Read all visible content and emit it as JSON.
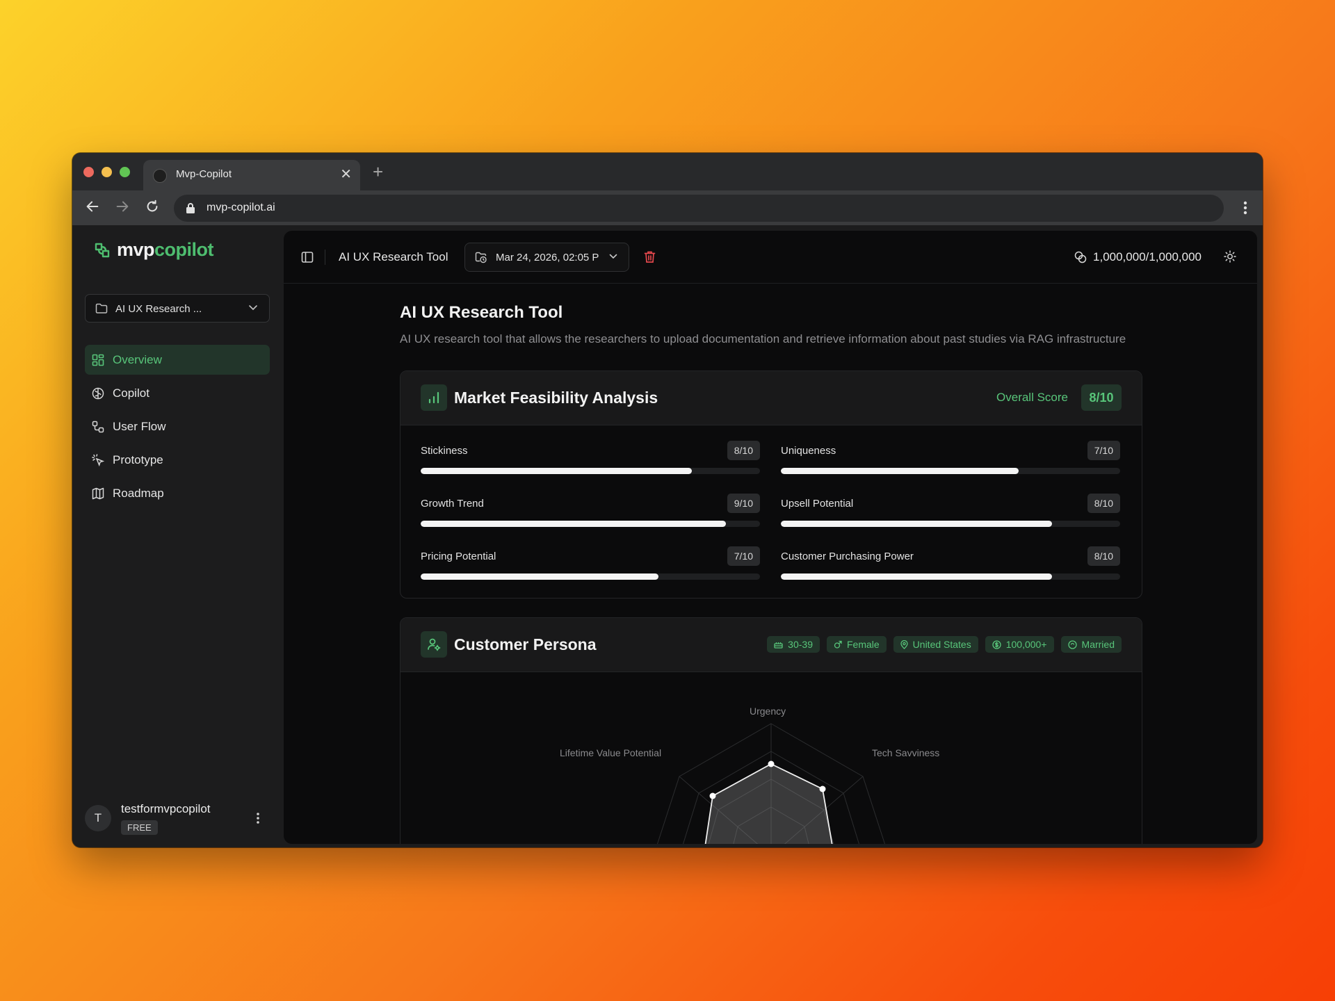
{
  "browser": {
    "tab_title": "Mvp-Copilot",
    "url": "mvp-copilot.ai"
  },
  "sidebar": {
    "logo_mvp": "mvp",
    "logo_copilot": "copilot",
    "project_selector": "AI UX Research ...",
    "nav": [
      {
        "label": "Overview",
        "icon": "overview-grid-icon",
        "active": true
      },
      {
        "label": "Copilot",
        "icon": "brain-icon"
      },
      {
        "label": "User Flow",
        "icon": "flow-icon"
      },
      {
        "label": "Prototype",
        "icon": "pointer-click-icon"
      },
      {
        "label": "Roadmap",
        "icon": "map-icon"
      }
    ],
    "user": {
      "initial": "T",
      "name": "testformvpcopilot",
      "plan": "FREE"
    }
  },
  "topbar": {
    "title": "AI UX Research Tool",
    "date": "Mar 24, 2026, 02:05 P",
    "credits": "1,000,000/1,000,000"
  },
  "page": {
    "title": "AI UX Research Tool",
    "description": "AI UX research tool that allows the researchers to upload documentation and retrieve information about past studies via RAG infrastructure"
  },
  "market": {
    "title": "Market Feasibility Analysis",
    "overall_label": "Overall Score",
    "overall_value": "8/10",
    "metrics": [
      {
        "label": "Stickiness",
        "value": "8/10",
        "fraction": 0.8
      },
      {
        "label": "Uniqueness",
        "value": "7/10",
        "fraction": 0.7
      },
      {
        "label": "Growth Trend",
        "value": "9/10",
        "fraction": 0.9
      },
      {
        "label": "Upsell Potential",
        "value": "8/10",
        "fraction": 0.8
      },
      {
        "label": "Pricing Potential",
        "value": "7/10",
        "fraction": 0.7
      },
      {
        "label": "Customer Purchasing Power",
        "value": "8/10",
        "fraction": 0.8
      }
    ]
  },
  "persona": {
    "title": "Customer Persona",
    "badges": [
      {
        "label": "30-39",
        "icon": "age-icon"
      },
      {
        "label": "Female",
        "icon": "gender-icon"
      },
      {
        "label": "United States",
        "icon": "location-pin-icon"
      },
      {
        "label": "100,000+",
        "icon": "dollar-icon"
      },
      {
        "label": "Married",
        "icon": "rings-icon"
      }
    ],
    "radar_labels": {
      "top": "Urgency",
      "left": "Lifetime Value Potential",
      "right": "Tech Savviness"
    }
  },
  "colors": {
    "accent": "#58c57a",
    "danger": "#e5484d"
  }
}
